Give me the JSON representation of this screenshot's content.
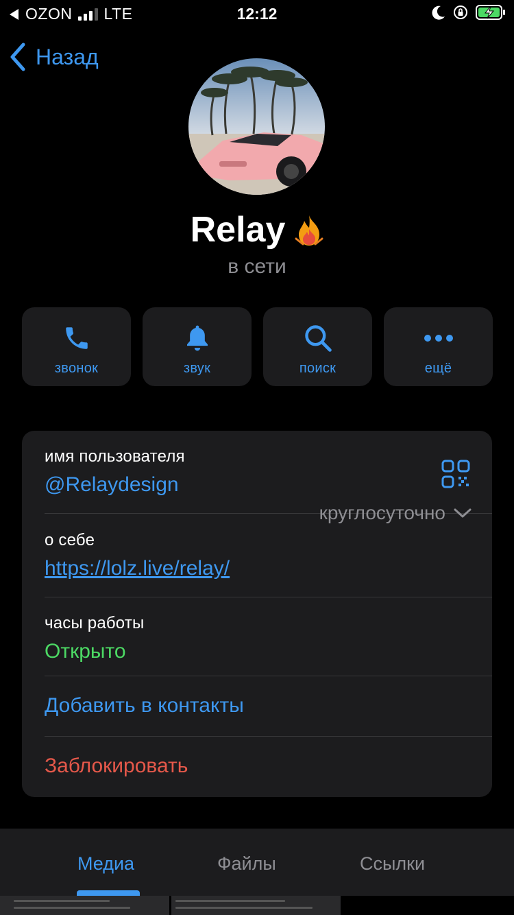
{
  "status_bar": {
    "carrier": "OZON",
    "network": "LTE",
    "time": "12:12"
  },
  "nav": {
    "back_label": "Назад"
  },
  "profile": {
    "name": "Relay",
    "status": "в сети",
    "name_badge_icon": "fire-icon"
  },
  "actions": [
    {
      "label": "звонок",
      "icon": "phone-icon"
    },
    {
      "label": "звук",
      "icon": "bell-icon"
    },
    {
      "label": "поиск",
      "icon": "search-icon"
    },
    {
      "label": "ещё",
      "icon": "more-icon"
    }
  ],
  "info": {
    "username_label": "имя пользователя",
    "username_value": "@Relaydesign",
    "bio_label": "о себе",
    "bio_value": "https://lolz.live/relay/",
    "hours_label": "часы работы",
    "hours_status": "Открыто",
    "hours_schedule": "круглосуточно",
    "add_contact": "Добавить в контакты",
    "block": "Заблокировать"
  },
  "tabs": [
    {
      "label": "Медиа",
      "active": true
    },
    {
      "label": "Файлы",
      "active": false
    },
    {
      "label": "Ссылки",
      "active": false
    }
  ],
  "colors": {
    "accent": "#3e98f0",
    "open": "#4cd964",
    "danger": "#e5584a",
    "card": "#1c1c1e",
    "secondary_text": "#8e8e93"
  }
}
